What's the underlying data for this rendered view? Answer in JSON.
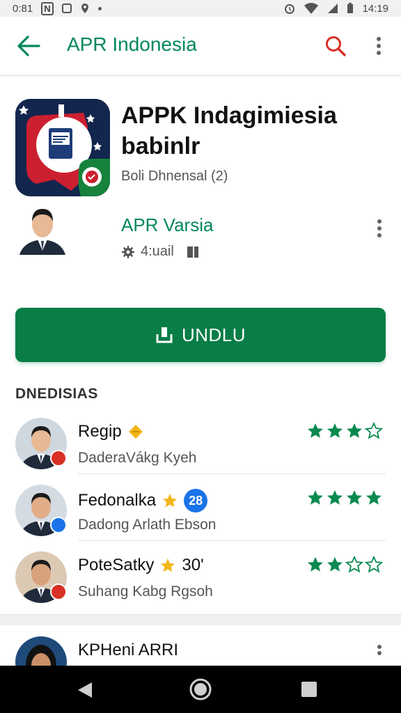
{
  "status_bar": {
    "time_left": "0:81",
    "letter": "N",
    "time_right": "14:19"
  },
  "app_bar": {
    "title": "APR Indonesia"
  },
  "app": {
    "title": "APPK Indagimiesia babinlr",
    "meta": "Boli Dhnensal (2)",
    "icon_colors": {
      "bg": "#13264d",
      "red": "#cc1f2f",
      "green": "#16823c"
    }
  },
  "developer": {
    "name": "APR Varsia",
    "sub_label": "4:uail"
  },
  "install_button": {
    "label": "UNDLU"
  },
  "section": {
    "title": "DNEDISIAS"
  },
  "reviews": [
    {
      "name": "Regip",
      "tag": "",
      "sub": "DaderaVákg Kyeh",
      "rating": 3,
      "badge_color": "#d93025",
      "icon_left": "shield-icon",
      "skin": "#e7b995",
      "bg": "#cfd7df"
    },
    {
      "name": "Fedonalka",
      "tag": "28",
      "sub": "Dadong Arlath Ebson",
      "rating": 4,
      "badge_color": "#1a73e8",
      "icon_left": "star-badge-icon",
      "skin": "#e0ad88",
      "bg": "#d4dbe3"
    },
    {
      "name": "PoteSatky",
      "tag": "30'",
      "sub": "Suhang Kabg Rgsoh",
      "rating": 2,
      "badge_color": "#d93025",
      "icon_left": "star-badge-icon",
      "skin": "#d9a27e",
      "bg": "#dcc9b3"
    }
  ],
  "bottom_item": {
    "name": "KPHeni ARRI"
  },
  "colors": {
    "accent": "#01875f",
    "install": "#087d46",
    "star_full": "#0a8a4f",
    "star_empty": "#0a8a4f",
    "search": "#d93025"
  }
}
